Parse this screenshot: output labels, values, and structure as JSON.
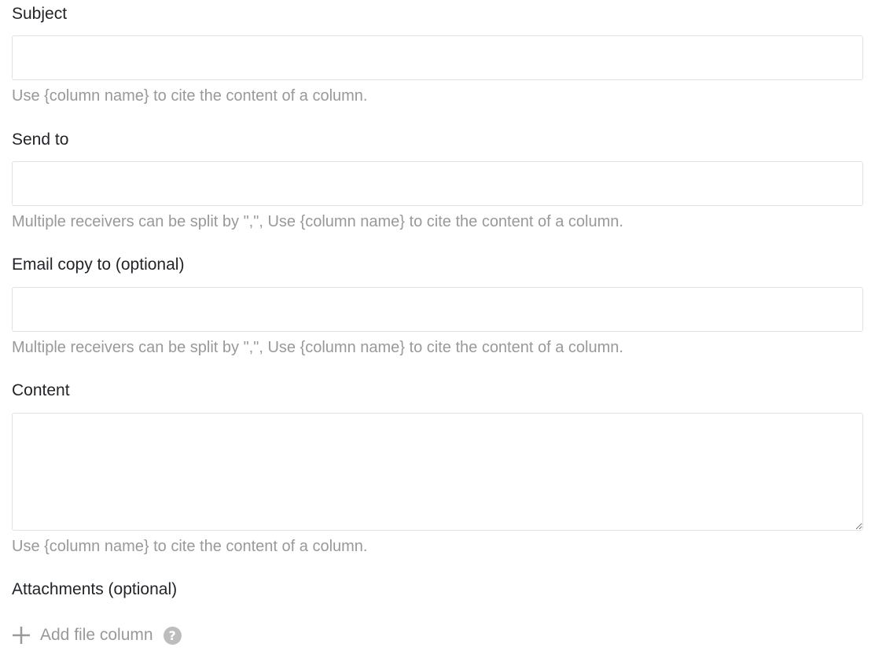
{
  "subject": {
    "label": "Subject",
    "value": "",
    "hint": "Use {column name} to cite the content of a column."
  },
  "send_to": {
    "label": "Send to",
    "value": "",
    "hint": "Multiple receivers can be split by \",\", Use {column name} to cite the content of a column."
  },
  "email_copy_to": {
    "label": "Email copy to (optional)",
    "value": "",
    "hint": "Multiple receivers can be split by \",\", Use {column name} to cite the content of a column."
  },
  "content": {
    "label": "Content",
    "value": "",
    "hint": "Use {column name} to cite the content of a column."
  },
  "attachments": {
    "label": "Attachments (optional)",
    "add_file_label": "Add file column",
    "help_icon": "?"
  },
  "colors": {
    "label_text": "#212529",
    "hint_text": "#999999",
    "border": "#dee2e6",
    "help_icon_bg": "#bdbdbd"
  },
  "icons": {
    "add": "plus-icon",
    "help": "question-circle-icon"
  }
}
